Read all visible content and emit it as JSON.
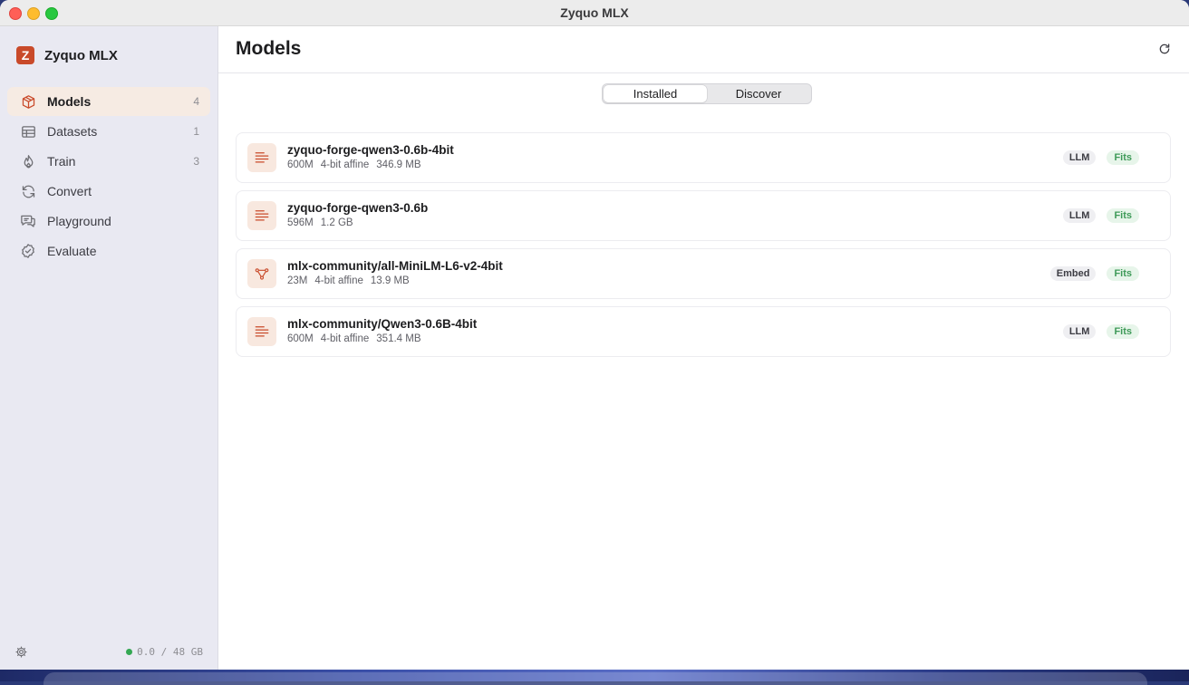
{
  "window": {
    "title": "Zyquo MLX"
  },
  "sidebar": {
    "brand": {
      "logo_letter": "Z",
      "name": "Zyquo MLX"
    },
    "items": [
      {
        "label": "Models",
        "count": "4",
        "icon": "cube-icon",
        "active": true
      },
      {
        "label": "Datasets",
        "count": "1",
        "icon": "table-icon"
      },
      {
        "label": "Train",
        "count": "3",
        "icon": "flame-icon"
      },
      {
        "label": "Convert",
        "count": "",
        "icon": "sync-icon"
      },
      {
        "label": "Playground",
        "count": "",
        "icon": "chat-bubbles-icon"
      },
      {
        "label": "Evaluate",
        "count": "",
        "icon": "checkmark-seal-icon"
      }
    ],
    "footer": {
      "memory": "0.0 / 48 GB",
      "settings_icon": "gear-icon"
    }
  },
  "main": {
    "title": "Models",
    "refresh_icon": "refresh-icon",
    "tabs": [
      {
        "label": "Installed",
        "selected": true
      },
      {
        "label": "Discover",
        "selected": false
      }
    ],
    "models": [
      {
        "name": "zyquo-forge-qwen3-0.6b-4bit",
        "params": "600M",
        "quant": "4-bit affine",
        "size": "346.9 MB",
        "type": "LLM",
        "fit": "Fits",
        "icon": "text-lines-icon"
      },
      {
        "name": "zyquo-forge-qwen3-0.6b",
        "params": "596M",
        "quant": "",
        "size": "1.2 GB",
        "type": "LLM",
        "fit": "Fits",
        "icon": "text-lines-icon"
      },
      {
        "name": "mlx-community/all-MiniLM-L6-v2-4bit",
        "params": "23M",
        "quant": "4-bit affine",
        "size": "13.9 MB",
        "type": "Embed",
        "fit": "Fits",
        "icon": "graph-nodes-icon"
      },
      {
        "name": "mlx-community/Qwen3-0.6B-4bit",
        "params": "600M",
        "quant": "4-bit affine",
        "size": "351.4 MB",
        "type": "LLM",
        "fit": "Fits",
        "icon": "text-lines-icon"
      }
    ]
  },
  "colors": {
    "accent": "#c94a2a",
    "fit_green": "#3e9a58",
    "sidebar_bg": "#e9e9f2"
  }
}
